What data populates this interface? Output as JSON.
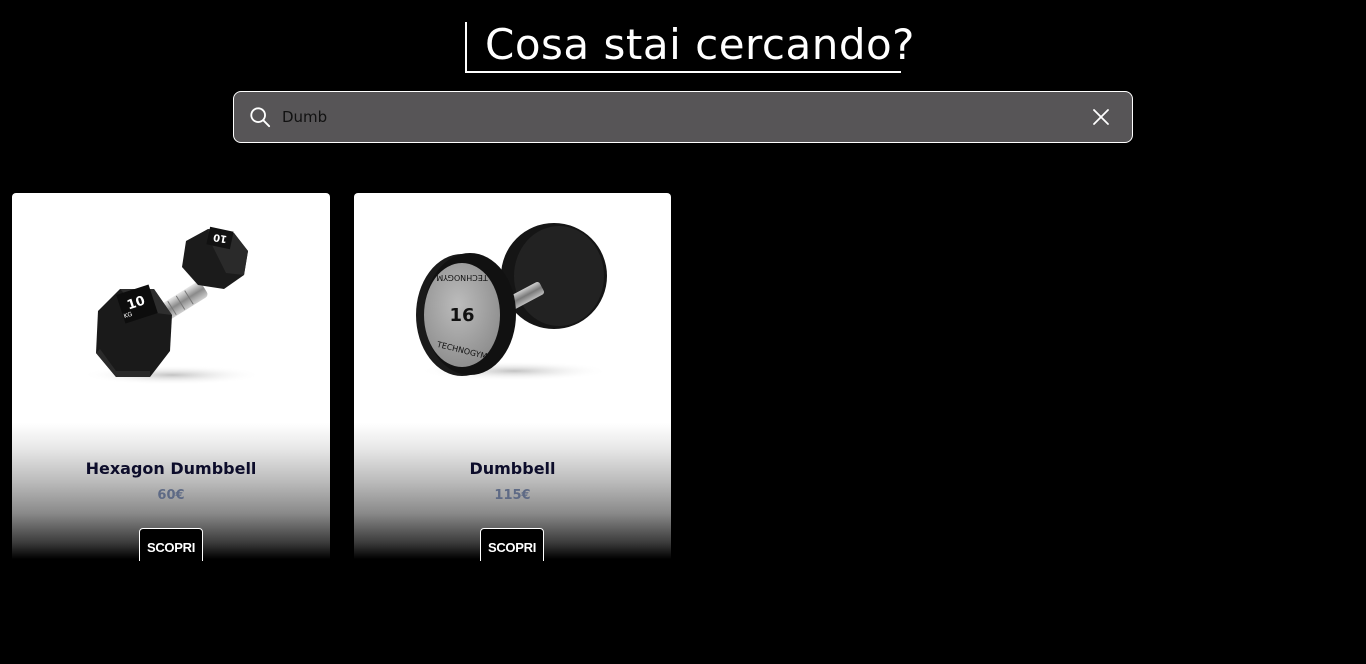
{
  "header": {
    "title": "Cosa stai cercando?"
  },
  "search": {
    "value": "Dumb",
    "placeholder": "",
    "search_icon": "search-icon",
    "clear_icon": "close-icon"
  },
  "products": [
    {
      "name": "Hexagon Dumbbell",
      "price": "60€",
      "button_label": "SCOPRI",
      "image": "hexagon-dumbbell-image",
      "plate_label": "10",
      "plate_unit": "KG"
    },
    {
      "name": "Dumbbell",
      "price": "115€",
      "button_label": "SCOPRI",
      "image": "round-dumbbell-image",
      "plate_label": "16",
      "brand": "TECHNOGYM"
    }
  ],
  "colors": {
    "background": "#000000",
    "search_bg": "#575557",
    "product_name": "#0d0d2b",
    "price": "#5e6a85"
  }
}
